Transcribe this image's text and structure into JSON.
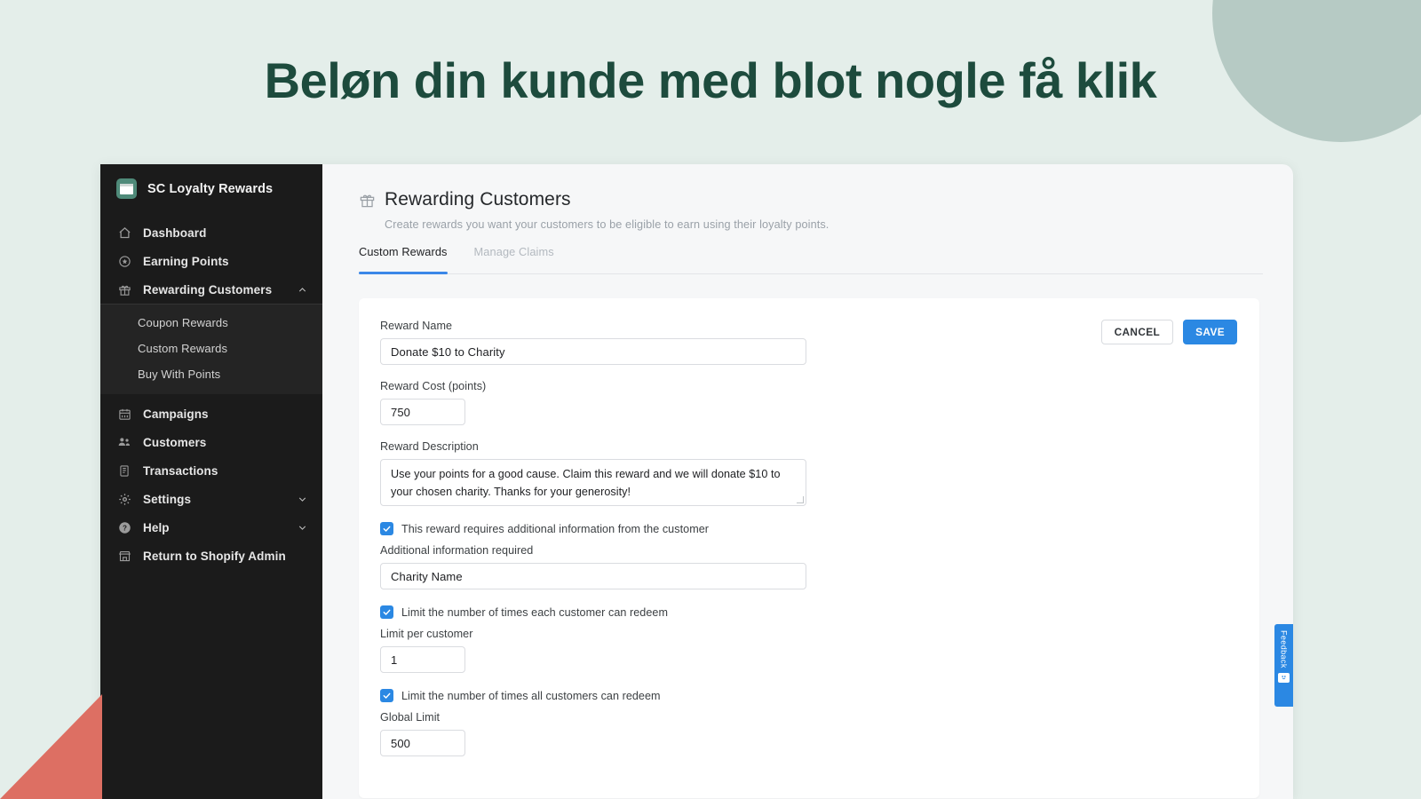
{
  "headline": "Beløn din kunde med blot nogle få klik",
  "sidebar": {
    "brand": "SC Loyalty Rewards",
    "items": [
      {
        "label": "Dashboard",
        "icon": "home-icon"
      },
      {
        "label": "Earning Points",
        "icon": "star-badge-icon"
      },
      {
        "label": "Rewarding Customers",
        "icon": "gift-icon",
        "expanded": true
      },
      {
        "label": "Campaigns",
        "icon": "calendar-icon"
      },
      {
        "label": "Customers",
        "icon": "people-icon"
      },
      {
        "label": "Transactions",
        "icon": "document-icon"
      },
      {
        "label": "Settings",
        "icon": "gear-icon"
      },
      {
        "label": "Help",
        "icon": "help-circle-icon"
      },
      {
        "label": "Return to Shopify Admin",
        "icon": "store-icon"
      }
    ],
    "submenu": [
      {
        "label": "Coupon Rewards"
      },
      {
        "label": "Custom Rewards"
      },
      {
        "label": "Buy With Points"
      }
    ]
  },
  "page": {
    "title": "Rewarding Customers",
    "subtitle": "Create rewards you want your customers to be eligible to earn using their loyalty points.",
    "tabs": [
      {
        "label": "Custom Rewards",
        "active": true
      },
      {
        "label": "Manage Claims",
        "active": false
      }
    ]
  },
  "form": {
    "actions": {
      "cancel": "CANCEL",
      "save": "SAVE"
    },
    "reward_name": {
      "label": "Reward Name",
      "value": "Donate $10 to Charity"
    },
    "reward_cost": {
      "label": "Reward Cost (points)",
      "value": "750"
    },
    "reward_description": {
      "label": "Reward Description",
      "value": "Use your points for a good cause. Claim this reward and we will donate $10 to your chosen charity. Thanks for your generosity!"
    },
    "additional_info_checkbox": {
      "label": "This reward requires additional information from the customer",
      "checked": true
    },
    "additional_info": {
      "label": "Additional information required",
      "value": "Charity Name"
    },
    "limit_per_customer_checkbox": {
      "label": "Limit the number of times each customer can redeem",
      "checked": true
    },
    "limit_per_customer": {
      "label": "Limit per customer",
      "value": "1"
    },
    "global_limit_checkbox": {
      "label": "Limit the number of times all customers can redeem",
      "checked": true
    },
    "global_limit": {
      "label": "Global Limit",
      "value": "500"
    }
  },
  "feedback": {
    "label": "Feedback"
  },
  "colors": {
    "background": "#e4eeea",
    "headline": "#1d4b3d",
    "accent_blue": "#2b88e3",
    "sidebar": "#1b1b1b",
    "triangle": "#dd6f63",
    "circle": "#b6cac4"
  }
}
